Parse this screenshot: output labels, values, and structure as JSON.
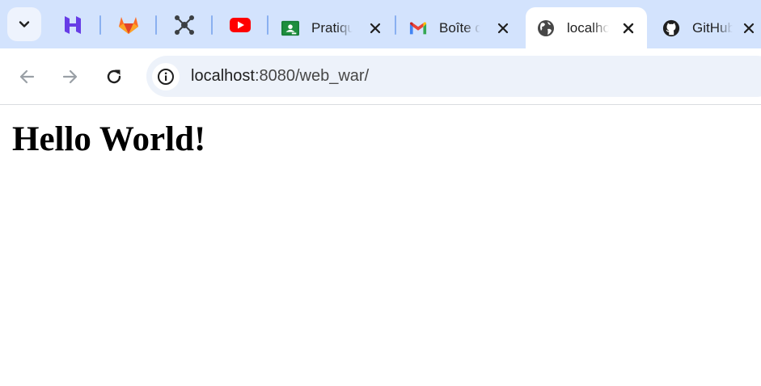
{
  "tabstrip": {
    "search_tabs_icon": "chevron-down-icon",
    "pinned": [
      {
        "icon": "hostinger-icon",
        "color": "#673de6"
      },
      {
        "icon": "gitlab-icon",
        "color": "#e24329"
      },
      {
        "icon": "graph-nodes-icon",
        "color": "#3c4043"
      },
      {
        "icon": "youtube-icon",
        "color": "#ff0000"
      }
    ],
    "tabs": [
      {
        "title": "Pratique",
        "icon": "google-classroom-icon",
        "active": false,
        "closable": true
      },
      {
        "title": "Boîte de réception",
        "icon": "gmail-icon",
        "active": false,
        "closable": true
      },
      {
        "title": "localhost",
        "icon": "globe-icon",
        "active": true,
        "closable": true
      },
      {
        "title": "GitHub",
        "icon": "github-icon",
        "active": false,
        "closable": true
      }
    ]
  },
  "toolbar": {
    "back_icon": "back-arrow-icon",
    "forward_icon": "forward-arrow-icon",
    "reload_icon": "reload-icon",
    "site_info_icon": "info-icon",
    "url_host": "localhost",
    "url_path": ":8080/web_war/"
  },
  "page": {
    "heading": "Hello World!"
  },
  "colors": {
    "tabstrip_bg": "#d3e3fd",
    "omnibox_bg": "#edf2fa",
    "separator": "#8ab0f0"
  }
}
